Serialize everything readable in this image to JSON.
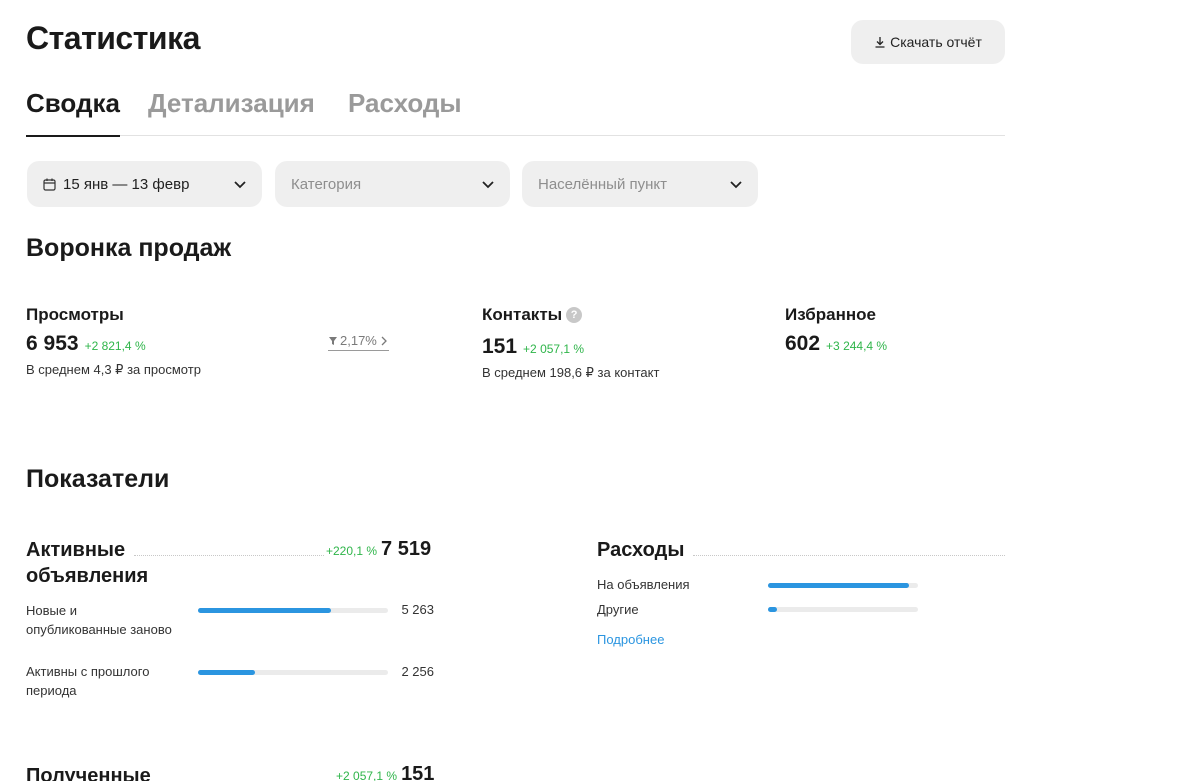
{
  "header": {
    "title": "Статистика",
    "download_label": "Скачать отчёт"
  },
  "tabs": [
    {
      "label": "Сводка",
      "active": true
    },
    {
      "label": "Детализация",
      "active": false
    },
    {
      "label": "Расходы",
      "active": false
    }
  ],
  "filters": {
    "date": "15 янв — 13 февр",
    "category_placeholder": "Категория",
    "location_placeholder": "Населённый пункт"
  },
  "funnel": {
    "title": "Воронка продаж",
    "views": {
      "label": "Просмотры",
      "value": "6 953",
      "change": "+2 821,4 %",
      "sub": "В среднем 4,3 ₽ за просмотр"
    },
    "conversion": "2,17%",
    "contacts": {
      "label": "Контакты",
      "value": "151",
      "change": "+2 057,1 %",
      "sub": "В среднем 198,6 ₽ за контакт"
    },
    "favorites": {
      "label": "Избранное",
      "value": "602",
      "change": "+3 244,4 %"
    }
  },
  "indicators": {
    "title": "Показатели",
    "active_listings": {
      "title": "Активные объявления",
      "change": "+220,1 %",
      "total": "7 519",
      "rows": [
        {
          "label": "Новые и опубликованные заново",
          "value": "5 263",
          "share": 0.7
        },
        {
          "label": "Активны с прошлого периода",
          "value": "2 256",
          "share": 0.3
        }
      ]
    },
    "expenses": {
      "title": "Расходы",
      "rows": [
        {
          "label": "На объявления",
          "share": 0.94
        },
        {
          "label": "Другие",
          "share": 0.06
        }
      ],
      "more_link": "Подробнее"
    },
    "received": {
      "title": "Полученные",
      "change": "+2 057,1 %",
      "total": "151"
    }
  },
  "colors": {
    "accent": "#2b95e0",
    "positive": "#2fb54a",
    "filter_bg": "#efefef"
  }
}
